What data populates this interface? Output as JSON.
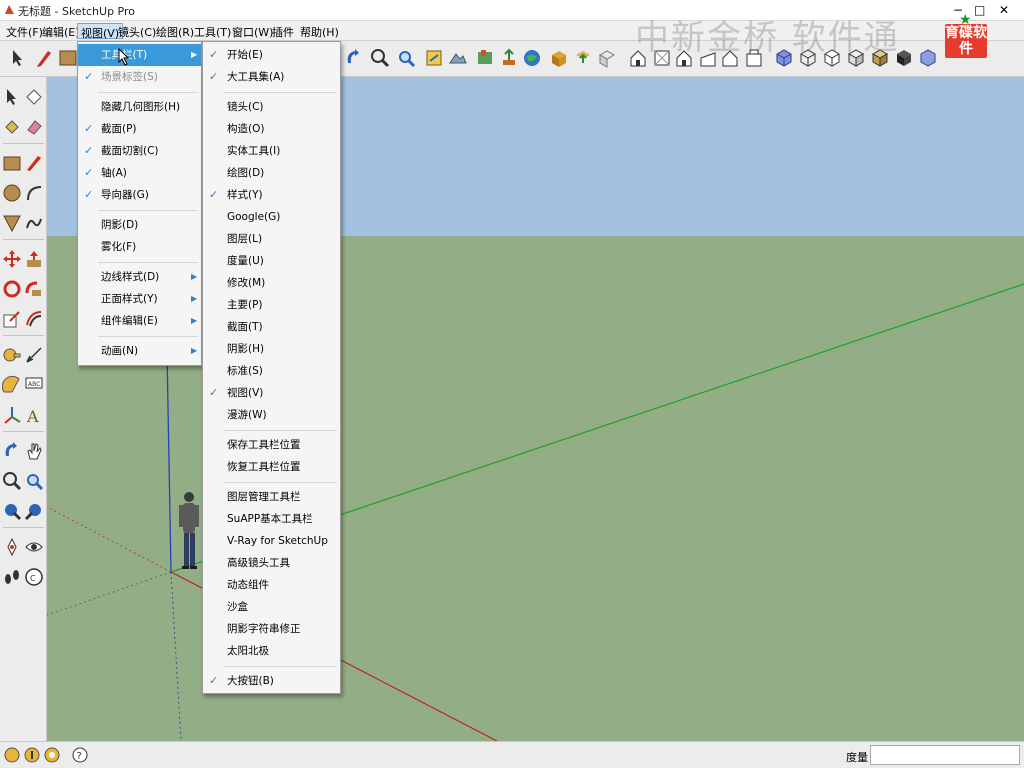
{
  "window": {
    "title": "无标题 - SketchUp Pro"
  },
  "watermark": {
    "text": "中新金桥  软件通",
    "badge": "育碟软件"
  },
  "menubar": [
    "文件(F)",
    "编辑(E)",
    "视图(V)",
    "镜头(C)",
    "绘图(R)",
    "工具(T)",
    "窗口(W)",
    "插件",
    "帮助(H)"
  ],
  "view_menu": {
    "items": [
      {
        "label": "工具栏(T)",
        "check": false,
        "submenu": true,
        "highlighted": true
      },
      {
        "label": "场景标签(S)",
        "check": true,
        "disabled": true
      },
      {
        "label": "隐藏几何图形(H)",
        "check": false
      },
      {
        "label": "截面(P)",
        "check": true
      },
      {
        "label": "截面切割(C)",
        "check": true
      },
      {
        "label": "轴(A)",
        "check": true
      },
      {
        "label": "导向器(G)",
        "check": true
      },
      {
        "label": "阴影(D)",
        "check": false
      },
      {
        "label": "雾化(F)",
        "check": false
      },
      {
        "label": "边线样式(D)",
        "check": false,
        "submenu": true
      },
      {
        "label": "正面样式(Y)",
        "check": false,
        "submenu": true
      },
      {
        "label": "组件编辑(E)",
        "check": false,
        "submenu": true
      },
      {
        "label": "动画(N)",
        "check": false,
        "submenu": true
      }
    ]
  },
  "toolbars_submenu": {
    "items": [
      {
        "label": "开始(E)",
        "check": true
      },
      {
        "label": "大工具集(A)",
        "check": true
      },
      {
        "label": "镜头(C)",
        "check": false
      },
      {
        "label": "构造(O)",
        "check": false
      },
      {
        "label": "实体工具(I)",
        "check": false
      },
      {
        "label": "绘图(D)",
        "check": false
      },
      {
        "label": "样式(Y)",
        "check": true
      },
      {
        "label": "Google(G)",
        "check": false
      },
      {
        "label": "图层(L)",
        "check": false
      },
      {
        "label": "度量(U)",
        "check": false
      },
      {
        "label": "修改(M)",
        "check": false
      },
      {
        "label": "主要(P)",
        "check": false
      },
      {
        "label": "截面(T)",
        "check": false
      },
      {
        "label": "阴影(H)",
        "check": false
      },
      {
        "label": "标准(S)",
        "check": false
      },
      {
        "label": "视图(V)",
        "check": true
      },
      {
        "label": "漫游(W)",
        "check": false
      },
      {
        "label": "保存工具栏位置",
        "check": false
      },
      {
        "label": "恢复工具栏位置",
        "check": false
      },
      {
        "label": "图层管理工具栏",
        "check": false
      },
      {
        "label": "SuAPP基本工具栏",
        "check": false
      },
      {
        "label": "V-Ray for SketchUp",
        "check": false
      },
      {
        "label": "高级镜头工具",
        "check": false
      },
      {
        "label": "动态组件",
        "check": false
      },
      {
        "label": "沙盒",
        "check": false
      },
      {
        "label": "阴影字符串修正",
        "check": false
      },
      {
        "label": "太阳北极",
        "check": false
      },
      {
        "label": "大按钮(B)",
        "check": true
      }
    ]
  },
  "statusbar": {
    "measure_label": "度量",
    "measure_value": ""
  },
  "colors": {
    "sky": "#a3c2e2",
    "ground": "#93ae86",
    "accent": "#3a9ad9",
    "check": "#3a7cc7"
  }
}
